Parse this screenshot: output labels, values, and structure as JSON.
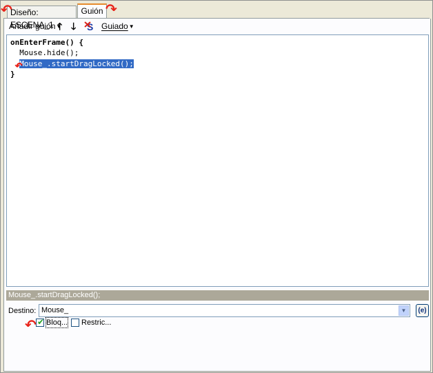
{
  "tabs": [
    {
      "label": "Diseño: ESCENA_1"
    },
    {
      "label": "Guión"
    }
  ],
  "toolbar": {
    "add_script": "Añadir guión",
    "up_icon": "arrow-up-icon",
    "down_icon": "arrow-down-icon",
    "delete_icon": "delete-script-icon",
    "guided": "Guiado"
  },
  "editor": {
    "lines": [
      "onEnterFrame() {",
      "  Mouse.hide();",
      "  Mouse_.startDragLocked();",
      "}"
    ],
    "selected_line": 3
  },
  "status_text": "Mouse_.startDragLocked();",
  "destino": {
    "label": "Destino:",
    "value": "Mouse_",
    "e_button": "(e)"
  },
  "options": [
    {
      "label": "Bloq...",
      "checked": true
    },
    {
      "label": "Restric...",
      "checked": false
    }
  ],
  "colors": {
    "accent_marker": "#e8231a",
    "selection": "#316ac5",
    "active_tab_top": "#e68b2c"
  }
}
